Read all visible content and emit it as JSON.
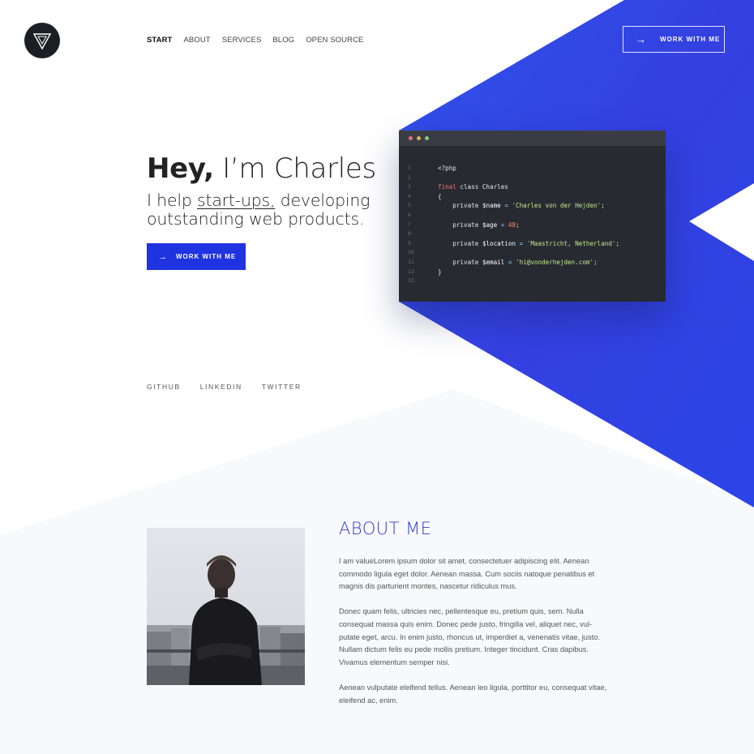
{
  "header": {
    "nav": [
      "START",
      "ABOUT",
      "SERVICES",
      "BLOG",
      "OPEN SOURCE"
    ],
    "cta": {
      "arrow": "→",
      "label": "WORK WITH ME"
    }
  },
  "hero": {
    "title_bold": "Hey,",
    "title_rest": " I’m Charles",
    "subtitle_pre": "I help ",
    "subtitle_link": "start-ups,",
    "subtitle_post": " developing outstanding web products.",
    "cta": {
      "arrow": "→",
      "label": "WORK WITH ME"
    }
  },
  "code": {
    "dots": [
      "#e2707a",
      "#d9b75a",
      "#7ccf7c"
    ],
    "line_numbers": [
      "1",
      "2",
      "3",
      "4",
      "5",
      "6",
      "7",
      "8",
      "9",
      "10",
      "11",
      "12",
      "13"
    ],
    "lines": [
      "<?php",
      "",
      "final class Charles",
      "{",
      "    private $name = 'Charles von der Hejden';",
      "",
      "    private $age = 48;",
      "",
      "    private $location = 'Maastricht, Netherland';",
      "",
      "    private $email = 'hi@vonderhejden.com';",
      "}",
      ""
    ]
  },
  "social": [
    "GITHUB",
    "LINKEDIN",
    "TWITTER"
  ],
  "about": {
    "title": "ABOUT ME",
    "paragraphs": [
      "I am valueLorem ipsum dolor sit amet, consectetuer adipiscing elit. Aenean commodo ligula eget dolor. Aenean massa. Cum sociis natoque penatibus et magnis dis parturient montes, nascetur ridiculus mus.",
      "Donec quam felis, ultricies nec, pellentesque eu, pretium quis, sem. Nulla consequat massa quis enim. Donec pede justo, fringilla vel, aliquet nec, vul-putate eget, arcu. In enim justo, rhoncus ut, imperdiet a, venenatis vitae, justo. Nullam dictum felis eu pede mollis pretium. Integer tincidunt. Cras dapibus. Vivamus elementum semper nisi.",
      "Aenean vulputate eleifend tellus. Aenean leo ligula, porttitor eu, consequat vitae, eleifend ac, enim."
    ]
  },
  "colors": {
    "accent_blue": "#2a42e8",
    "button_blue": "#1f33e0",
    "dark": "#1c1e24",
    "code_bg": "#282a31",
    "page_bg_light": "#f8f9fc"
  },
  "icons": {
    "logo": "triangle-logo-icon",
    "arrow": "arrow-right-icon"
  }
}
